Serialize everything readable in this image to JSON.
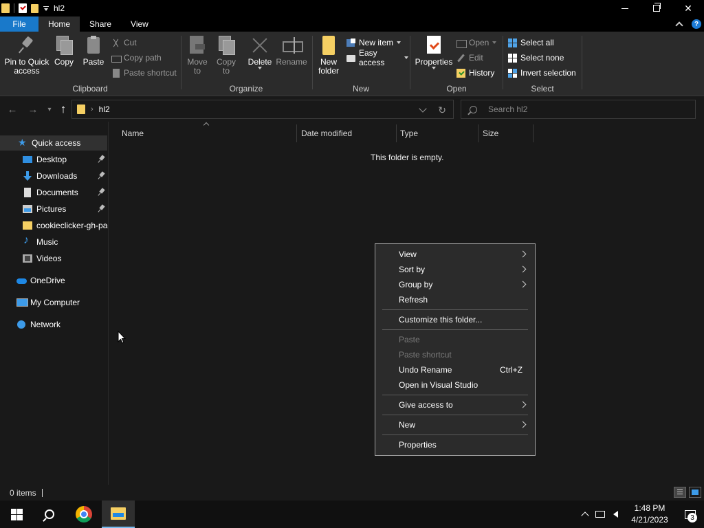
{
  "window": {
    "title": "hl2"
  },
  "tabs": [
    {
      "label": "File"
    },
    {
      "label": "Home"
    },
    {
      "label": "Share"
    },
    {
      "label": "View"
    }
  ],
  "ribbon": {
    "clipboard": {
      "label": "Clipboard",
      "pin_line1": "Pin to Quick",
      "pin_line2": "access",
      "copy": "Copy",
      "paste": "Paste",
      "cut": "Cut",
      "copy_path": "Copy path",
      "paste_shortcut": "Paste shortcut"
    },
    "organize": {
      "label": "Organize",
      "move_line1": "Move",
      "move_line2": "to",
      "copyto_line1": "Copy",
      "copyto_line2": "to",
      "delete": "Delete",
      "rename": "Rename"
    },
    "new": {
      "label": "New",
      "new_folder_line1": "New",
      "new_folder_line2": "folder",
      "new_item": "New item",
      "easy_access": "Easy access"
    },
    "open": {
      "label": "Open",
      "properties": "Properties",
      "open": "Open",
      "edit": "Edit",
      "history": "History"
    },
    "select": {
      "label": "Select",
      "select_all": "Select all",
      "select_none": "Select none",
      "invert": "Invert selection"
    }
  },
  "address": {
    "path": "hl2",
    "search_placeholder": "Search hl2"
  },
  "nav": {
    "items": [
      {
        "label": "Quick access",
        "icon": "star-icon"
      },
      {
        "label": "Desktop",
        "icon": "desktop-icon",
        "pinned": true
      },
      {
        "label": "Downloads",
        "icon": "download-icon",
        "pinned": true
      },
      {
        "label": "Documents",
        "icon": "documents-icon",
        "pinned": true
      },
      {
        "label": "Pictures",
        "icon": "pictures-icon",
        "pinned": true
      },
      {
        "label": "cookieclicker-gh-pages",
        "icon": "folder-icon"
      },
      {
        "label": "Music",
        "icon": "music-icon"
      },
      {
        "label": "Videos",
        "icon": "videos-icon"
      },
      {
        "label": "OneDrive",
        "icon": "cloud-icon"
      },
      {
        "label": "My Computer",
        "icon": "computer-icon"
      },
      {
        "label": "Network",
        "icon": "network-icon"
      }
    ]
  },
  "columns": [
    {
      "label": "Name"
    },
    {
      "label": "Date modified"
    },
    {
      "label": "Type"
    },
    {
      "label": "Size"
    }
  ],
  "content": {
    "empty_message": "This folder is empty."
  },
  "context_menu": {
    "items": [
      {
        "label": "View",
        "submenu": true
      },
      {
        "label": "Sort by",
        "submenu": true
      },
      {
        "label": "Group by",
        "submenu": true
      },
      {
        "label": "Refresh"
      },
      {
        "label": "Customize this folder..."
      },
      {
        "label": "Paste",
        "disabled": true
      },
      {
        "label": "Paste shortcut",
        "disabled": true
      },
      {
        "label": "Undo Rename",
        "shortcut": "Ctrl+Z"
      },
      {
        "label": "Open in Visual Studio"
      },
      {
        "label": "Give access to",
        "submenu": true
      },
      {
        "label": "New",
        "submenu": true
      },
      {
        "label": "Properties"
      }
    ]
  },
  "status": {
    "item_count": "0 items"
  },
  "taskbar": {
    "time": "1:48 PM",
    "date": "4/21/2023",
    "notification_count": "3"
  },
  "colors": {
    "accent": "#1979ca",
    "folder": "#f5cf63",
    "background": "#191919",
    "ribbon": "#2b2b2b"
  }
}
